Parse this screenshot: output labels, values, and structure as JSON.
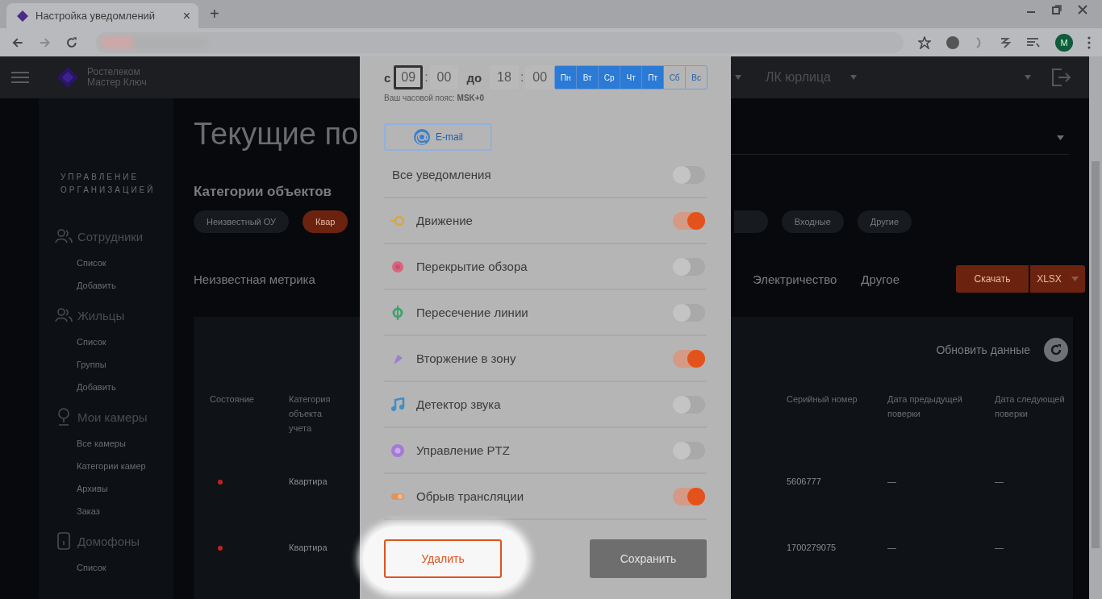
{
  "browser": {
    "tab_title": "Настройка уведомлений",
    "close_tab": "×",
    "new_tab": "+",
    "profile_initial": "M"
  },
  "header": {
    "logo_lines": [
      "Ростелеком",
      "Мастер Ключ"
    ],
    "account": "ЛК юрлица"
  },
  "sidebar": {
    "section_title": "УПРАВЛЕНИЕ ОРГАНИЗАЦИЕЙ",
    "groups": [
      {
        "label": "Сотрудники",
        "items": [
          "Список",
          "Добавить"
        ]
      },
      {
        "label": "Жильцы",
        "items": [
          "Список",
          "Группы",
          "Добавить"
        ]
      },
      {
        "label": "Мои камеры",
        "items": [
          "Все камеры",
          "Категории камер",
          "Архивы",
          "Заказ"
        ]
      },
      {
        "label": "Домофоны",
        "items": [
          "Список"
        ]
      }
    ]
  },
  "page": {
    "title": "Текущие по",
    "categories_heading": "Категории объектов",
    "chips": [
      {
        "label": "Неизвестный ОУ",
        "selected": false
      },
      {
        "label": "Квар",
        "selected": true
      },
      {
        "label": "Входные",
        "selected": false
      },
      {
        "label": "Другие",
        "selected": false
      }
    ],
    "metric_tabs_left": [
      "Неизвестная метрика"
    ],
    "metric_tabs_right": [
      "Электричество",
      "Другое"
    ],
    "download_button": "Скачать",
    "format_button": "XLSX",
    "refresh_label": "Обновить данные",
    "table": {
      "columns_left": [
        "Состояние",
        "Категория объекта учета"
      ],
      "columns_right": [
        "Серийный номер",
        "Дата предыдущей поверки",
        "Дата следующей поверки"
      ],
      "rows": [
        {
          "color": "#c0231b",
          "category": "Квартира",
          "serial": "5606777",
          "prev_check": "—",
          "next_check": "—"
        },
        {
          "color": "#c0231b",
          "category": "Квартира",
          "serial": "1700279075",
          "prev_check": "—",
          "next_check": "—"
        }
      ]
    }
  },
  "modal": {
    "from_label": "с",
    "from_hours": "09",
    "from_separator": ":",
    "from_minutes": "00",
    "to_label": "до",
    "to_hours": "18",
    "to_separator": ":",
    "to_minutes": "00",
    "days": [
      {
        "label": "Пн",
        "selected": true
      },
      {
        "label": "Вт",
        "selected": true
      },
      {
        "label": "Ср",
        "selected": true
      },
      {
        "label": "Чт",
        "selected": true
      },
      {
        "label": "Пт",
        "selected": true
      },
      {
        "label": "Сб",
        "selected": false
      },
      {
        "label": "Вс",
        "selected": false
      }
    ],
    "timezone_note": "Ваш часовой пояс: **MSK+0**",
    "channel_button": "E-mail",
    "notifications": [
      {
        "kind": "all",
        "label": "Все уведомления",
        "on": false
      },
      {
        "kind": "event",
        "label": "Движение",
        "on": true
      },
      {
        "kind": "event",
        "label": "Перекрытие обзора",
        "on": false
      },
      {
        "kind": "event",
        "label": "Пересечение линии",
        "on": false
      },
      {
        "kind": "event",
        "label": "Вторжение в зону",
        "on": true
      },
      {
        "kind": "event",
        "label": "Детектор звука",
        "on": false
      },
      {
        "kind": "event",
        "label": "Управление PTZ",
        "on": false
      },
      {
        "kind": "event",
        "label": "Обрыв трансляции",
        "on": true
      }
    ],
    "delete_button": "Удалить",
    "save_button": {
      "label": "Сохранить",
      "disabled": true
    }
  }
}
